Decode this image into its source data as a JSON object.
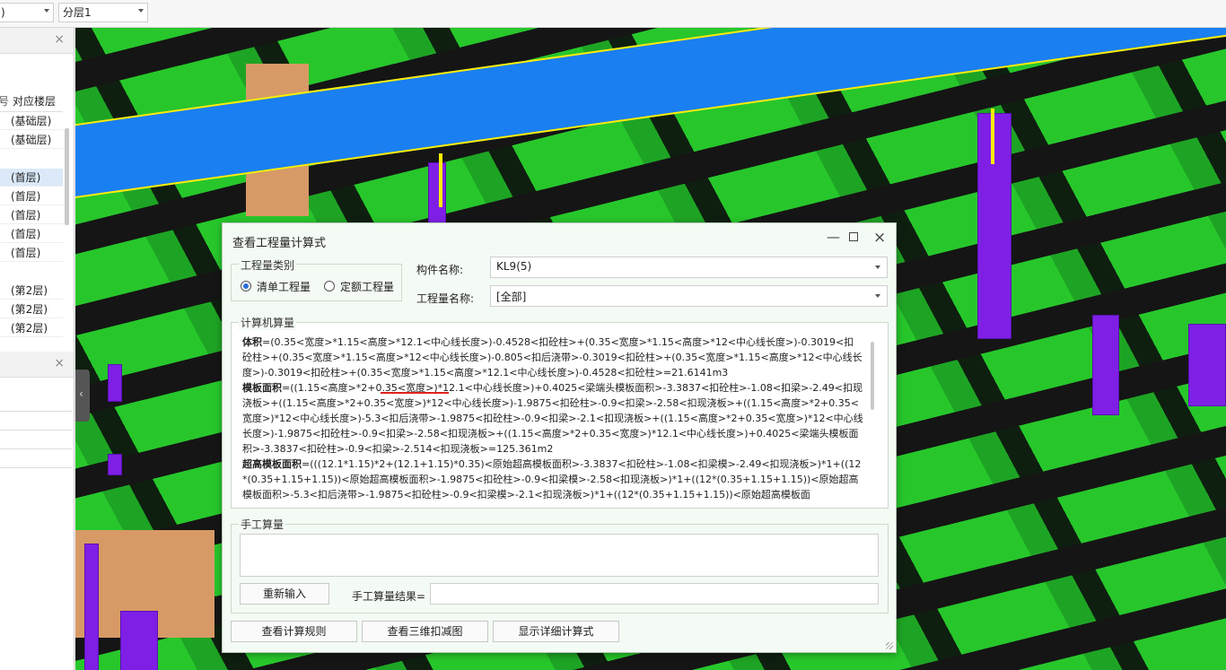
{
  "toolbar": {
    "combo_left_text": ")",
    "combo_layer": "分层1"
  },
  "left_panel": {
    "close_symbol": "×",
    "column_header": "对应楼层",
    "column_header_prefix": "号",
    "floors": [
      "(基础层)",
      "(基础层)",
      "(首层)",
      "(首层)",
      "(首层)",
      "(首层)",
      "(首层)",
      "(第2层)",
      "(第2层)",
      "(第2层)"
    ],
    "selected_index": 2
  },
  "dialog": {
    "title": "查看工程量计算式",
    "category_group_label": "工程量类别",
    "radio_list": "清单工程量",
    "radio_quota": "定额工程量",
    "selected_category": "清单工程量",
    "component_label": "构件名称:",
    "component_value": "KL9(5)",
    "quantity_label": "工程量名称:",
    "quantity_value": "[全部]",
    "computer_group_label": "计算机算量",
    "formula": {
      "vol_label": "体积",
      "vol_text": "=(0.35<宽度>*1.15<高度>*12.1<中心线长度>)-0.4528<扣砼柱>+(0.35<宽度>*1.15<高度>*12<中心线长度>)-0.3019<扣砼柱>+(0.35<宽度>*1.15<高度>*12<中心线长度>)-0.805<扣后浇带>-0.3019<扣砼柱>+(0.35<宽度>*1.15<高度>*12<中心线长度>)-0.3019<扣砼柱>+(0.35<宽度>*1.15<高度>*12.1<中心线长度>)-0.4528<扣砼柱>=21.6141m3",
      "form_label": "模板面积",
      "form_text": "=((1.15<高度>*2+0.35<宽度>)*12.1<中心线长度>)+0.4025<梁端头模板面积>-3.3837<扣砼柱>-1.08<扣梁>-2.49<扣现浇板>+((1.15<高度>*2+0.35<宽度>)*12<中心线长度>)-1.9875<扣砼柱>-0.9<扣梁>-2.58<扣现浇板>+((1.15<高度>*2+0.35<宽度>)*12<中心线长度>)-5.3<扣后浇带>-1.9875<扣砼柱>-0.9<扣梁>-2.1<扣现浇板>+((1.15<高度>*2+0.35<宽度>)*12<中心线长度>)-1.9875<扣砼柱>-0.9<扣梁>-2.58<扣现浇板>+((1.15<高度>*2+0.35<宽度>)*12.1<中心线长度>)+0.4025<梁端头模板面积>-3.3837<扣砼柱>-0.9<扣梁>-2.514<扣现浇板>=125.361m2",
      "high_label": "超高模板面积",
      "high_text": "=(((12.1*1.15)*2+(12.1+1.15)*0.35)<原始超高模板面积>-3.3837<扣砼柱>-1.08<扣梁模>-2.49<扣现浇板>)*1+((12*(0.35+1.15+1.15))<原始超高模板面积>-1.9875<扣砼柱>-0.9<扣梁模>-2.58<扣现浇板>)*1+((12*(0.35+1.15+1.15))<原始超高模板面积>-5.3<扣后浇带>-1.9875<扣砼柱>-0.9<扣梁模>-2.1<扣现浇板>)*1+((12*(0.35+1.15+1.15))<原始超高模板面"
    },
    "manual_group_label": "手工算量",
    "btn_reenter": "重新输入",
    "manual_result_label": "手工算量结果=",
    "btn_rules": "查看计算规则",
    "btn_3d": "查看三维扣减图",
    "btn_detail": "显示详细计算式"
  },
  "colors": {
    "beam_green": "#27c72b",
    "selected_beam_blue": "#1a7ff0",
    "column_purple": "#7f1fe6",
    "highlight_yellow": "#ffee00"
  }
}
